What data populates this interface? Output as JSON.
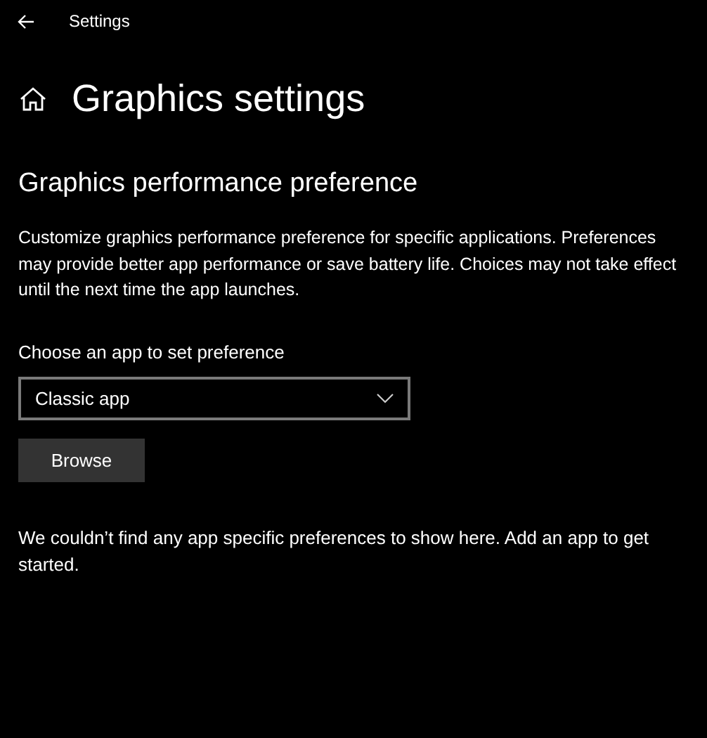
{
  "window": {
    "title": "Settings"
  },
  "page_title": "Graphics settings",
  "section_title": "Graphics performance preference",
  "description": "Customize graphics performance preference for specific applications. Preferences may provide better app performance or save battery life. Choices may not take effect until the next time the app launches.",
  "app_picker": {
    "label": "Choose an app to set preference",
    "value": "Classic app"
  },
  "buttons": [
    "Browse"
  ],
  "empty_message": "We couldn’t find any app specific preferences to show here. Add an app to get started."
}
